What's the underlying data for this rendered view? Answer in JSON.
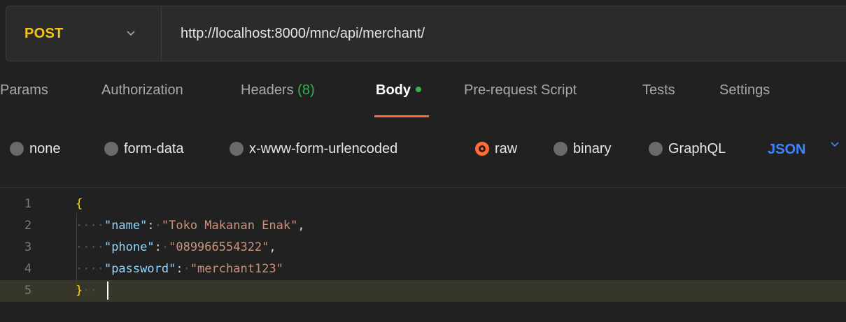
{
  "request": {
    "method": "POST",
    "url": "http://localhost:8000/mnc/api/merchant/"
  },
  "tabs": [
    {
      "label": "Params"
    },
    {
      "label": "Authorization"
    },
    {
      "label": "Headers",
      "count": "(8)"
    },
    {
      "label": "Body",
      "active": true
    },
    {
      "label": "Pre-request Script"
    },
    {
      "label": "Tests"
    },
    {
      "label": "Settings"
    }
  ],
  "body_types": [
    {
      "label": "none"
    },
    {
      "label": "form-data"
    },
    {
      "label": "x-www-form-urlencoded"
    },
    {
      "label": "raw",
      "selected": true
    },
    {
      "label": "binary"
    },
    {
      "label": "GraphQL"
    }
  ],
  "format": "JSON",
  "editor": {
    "line_numbers": [
      "1",
      "2",
      "3",
      "4",
      "5"
    ],
    "open_brace": "{",
    "close_brace": "}",
    "fields": [
      {
        "key": "\"name\"",
        "value": "\"Toko Makanan Enak\""
      },
      {
        "key": "\"phone\"",
        "value": "\"089966554322\""
      },
      {
        "key": "\"password\"",
        "value": "\"merchant123\""
      }
    ]
  },
  "colors": {
    "method": "#f5c518",
    "accent": "#ff6c37",
    "badge_green": "#37b24d",
    "json_blue": "#3b86ff"
  }
}
